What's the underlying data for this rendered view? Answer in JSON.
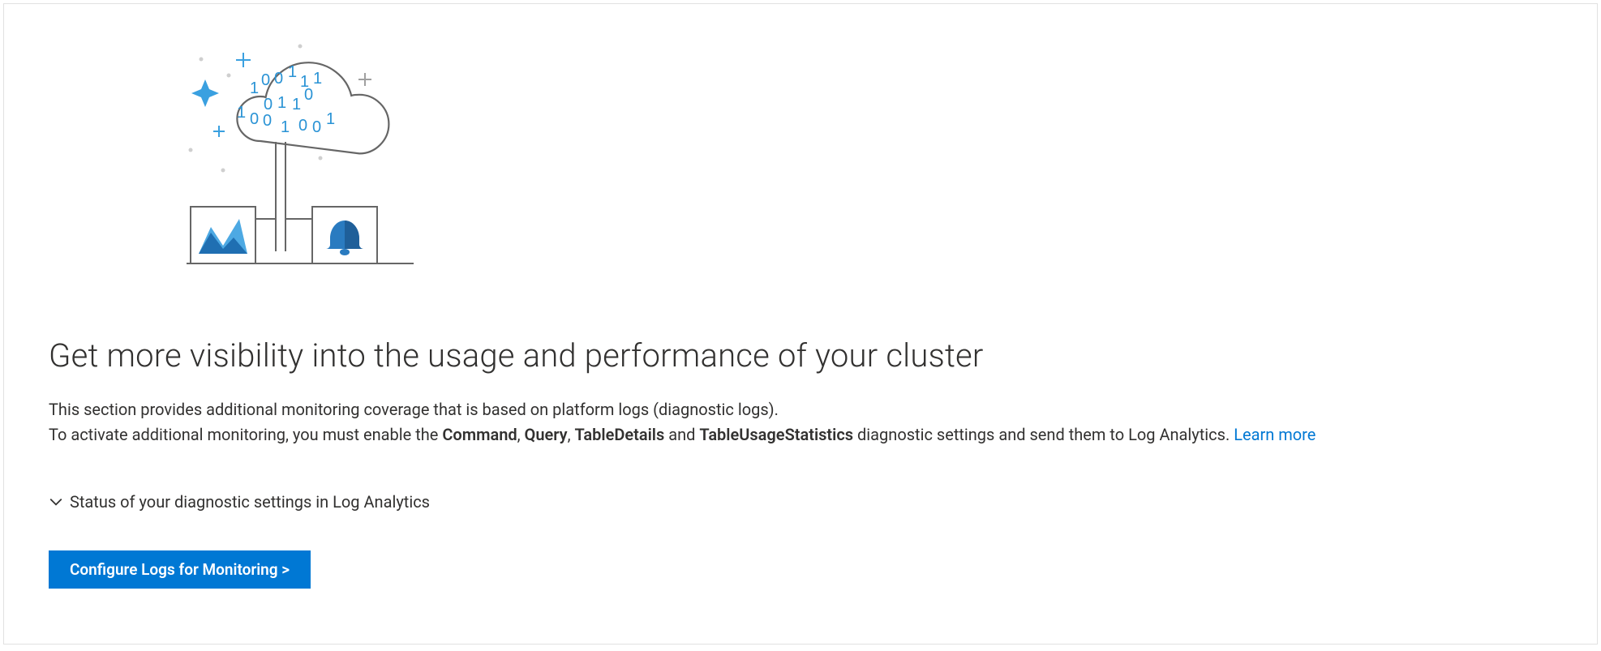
{
  "title": "Get more visibility into the usage and performance of your cluster",
  "desc": {
    "line1": "This section provides additional monitoring coverage that is based on platform logs (diagnostic logs).",
    "line2_pre": "To activate additional monitoring, you must enable the ",
    "b1": "Command",
    "sep1": ", ",
    "b2": "Query",
    "sep2": ", ",
    "b3": "TableDetails",
    "sep3": " and ",
    "b4": "TableUsageStatistics",
    "line2_post": " diagnostic settings and send them to Log Analytics. ",
    "learn": "Learn more"
  },
  "expander": {
    "label": "Status of your diagnostic settings in Log Analytics"
  },
  "cta": {
    "label": "Configure Logs for Monitoring >"
  }
}
